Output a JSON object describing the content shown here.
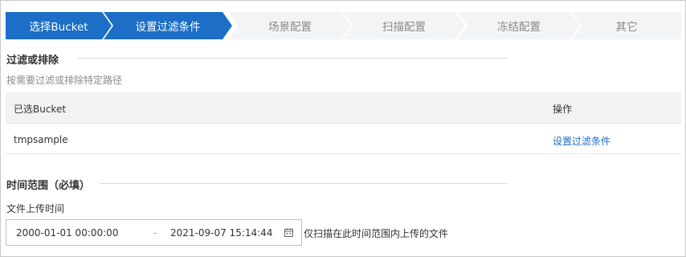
{
  "steps": [
    {
      "label": "选择Bucket",
      "state": "active"
    },
    {
      "label": "设置过滤条件",
      "state": "active"
    },
    {
      "label": "场景配置",
      "state": "inactive"
    },
    {
      "label": "扫描配置",
      "state": "inactive"
    },
    {
      "label": "冻结配置",
      "state": "inactive"
    },
    {
      "label": "其它",
      "state": "inactive"
    }
  ],
  "colors": {
    "step_active": "#1c6ec6",
    "step_inactive": "#f3f4f6",
    "link": "#1a6fc2"
  },
  "filter_section": {
    "title": "过滤或排除",
    "hint": "按需要过滤或排除特定路径"
  },
  "bucket_table": {
    "headers": [
      "已选Bucket",
      "操作"
    ],
    "rows": [
      {
        "bucket": "tmpsample",
        "action": "设置过滤条件"
      }
    ]
  },
  "time_section": {
    "title": "时间范围（必填）",
    "field_label": "文件上传时间",
    "start": "2000-01-01 00:00:00",
    "separator": "-",
    "end": "2021-09-07 15:14:44",
    "calendar_icon": "calendar-icon",
    "note": "仅扫描在此时间范围内上传的文件"
  }
}
